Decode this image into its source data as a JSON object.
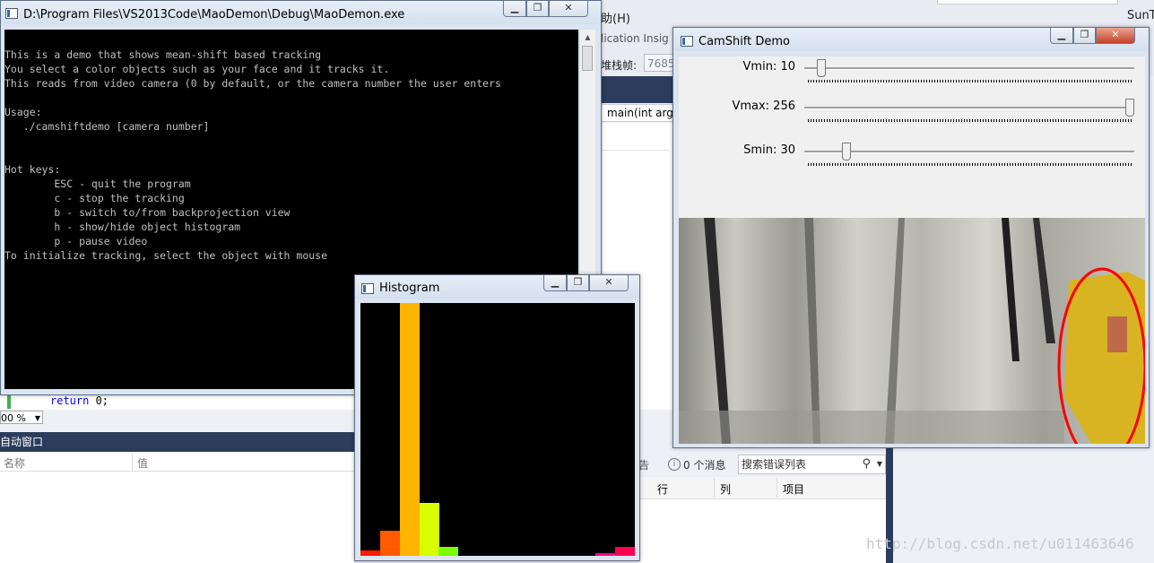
{
  "ide": {
    "menu_help": "助(H)",
    "user": "SunT",
    "app_insights": "lication Insig",
    "stack_label": "堆栈帧:",
    "stack_value": "7685",
    "function_combo": "main(int arg",
    "code_keyword": "return",
    "code_rest": " 0;",
    "zoom": "00 %",
    "autos_title": "自动窗口",
    "autos_col_name": "名称",
    "autos_col_value": "值",
    "err_tab_fragment": "告",
    "err_messages": "0 个消息",
    "err_search_placeholder": "搜索错误列表",
    "err_col_line": "行",
    "err_col_column": "列",
    "err_col_project": "项目",
    "watermark": "http://blog.csdn.net/u011463646"
  },
  "console": {
    "title": "D:\\Program Files\\VS2013Code\\MaoDemon\\Debug\\MaoDemon.exe",
    "lines": [
      "This is a demo that shows mean-shift based tracking",
      "You select a color objects such as your face and it tracks it.",
      "This reads from video camera (0 by default, or the camera number the user enters",
      "",
      "Usage:",
      "   ./camshiftdemo [camera number]",
      "",
      "",
      "Hot keys:",
      "        ESC - quit the program",
      "        c - stop the tracking",
      "        b - switch to/from backprojection view",
      "        h - show/hide object histogram",
      "        p - pause video",
      "To initialize tracking, select the object with mouse"
    ]
  },
  "camshift": {
    "title": "CamShift Demo",
    "trackbars": [
      {
        "label": "Vmin: 10",
        "value": 10,
        "max": 256
      },
      {
        "label": "Vmax: 256",
        "value": 256,
        "max": 256
      },
      {
        "label": "Smin: 30",
        "value": 30,
        "max": 256
      }
    ]
  },
  "histogram": {
    "title": "Histogram",
    "bins": [
      {
        "value": 0.02,
        "color": "#ff1a00"
      },
      {
        "value": 0.1,
        "color": "#ff5a00"
      },
      {
        "value": 1.0,
        "color": "#ffb400"
      },
      {
        "value": 0.21,
        "color": "#d8ff00"
      },
      {
        "value": 0.035,
        "color": "#7cff00"
      },
      {
        "value": 0,
        "color": "#00ff40"
      },
      {
        "value": 0,
        "color": "#00ffb0"
      },
      {
        "value": 0,
        "color": "#00e0ff"
      },
      {
        "value": 0,
        "color": "#0080ff"
      },
      {
        "value": 0,
        "color": "#1000ff"
      },
      {
        "value": 0,
        "color": "#8000ff"
      },
      {
        "value": 0,
        "color": "#ff00e0"
      },
      {
        "value": 0.01,
        "color": "#ff0090"
      },
      {
        "value": 0.035,
        "color": "#ff0050"
      }
    ]
  }
}
